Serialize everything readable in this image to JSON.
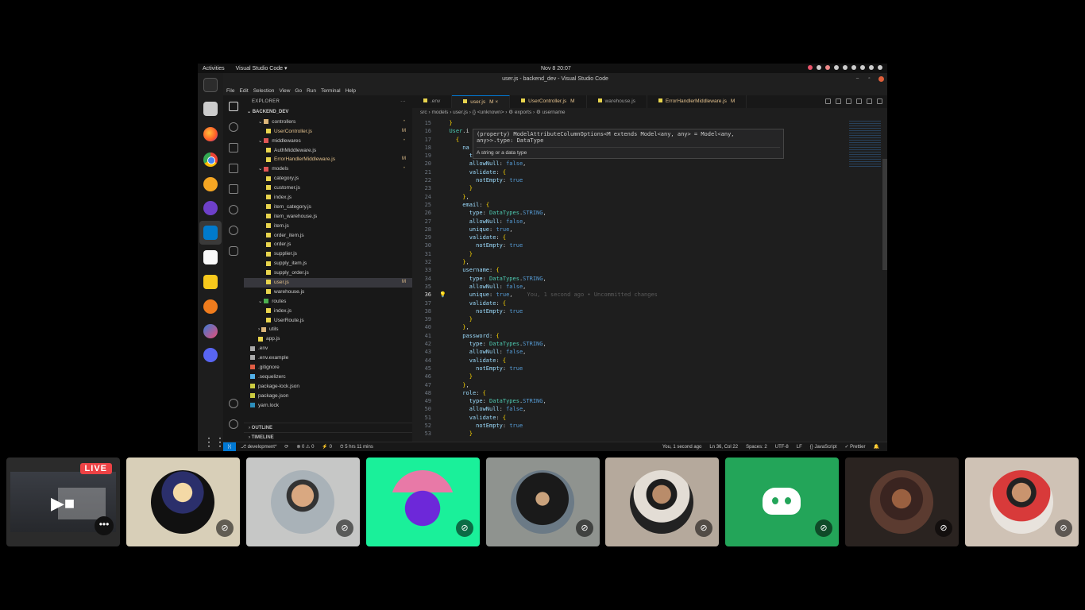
{
  "topbar": {
    "activities": "Activities",
    "app": "Visual Studio Code ▾",
    "clock": "Nov 8  20:07"
  },
  "window": {
    "title": "user.js - backend_dev - Visual Studio Code",
    "menu": [
      "File",
      "Edit",
      "Selection",
      "View",
      "Go",
      "Run",
      "Terminal",
      "Help"
    ]
  },
  "sidebar": {
    "title": "EXPLORER",
    "project": "BACKEND_DEV",
    "tree": [
      {
        "label": "controllers",
        "type": "folder",
        "indent": 1,
        "dot": "•"
      },
      {
        "label": "UserController.js",
        "type": "js",
        "indent": 2,
        "badge": "M"
      },
      {
        "label": "middlewares",
        "type": "folder mw",
        "indent": 1,
        "dot": "•"
      },
      {
        "label": "AuthMiddleware.js",
        "type": "js",
        "indent": 2
      },
      {
        "label": "ErrorHandlerMiddleware.js",
        "type": "js",
        "indent": 2,
        "badge": "M"
      },
      {
        "label": "models",
        "type": "folder mw",
        "indent": 1,
        "dot": "•"
      },
      {
        "label": "category.js",
        "type": "js",
        "indent": 2
      },
      {
        "label": "customer.js",
        "type": "js",
        "indent": 2
      },
      {
        "label": "index.js",
        "type": "js",
        "indent": 2
      },
      {
        "label": "item_category.js",
        "type": "js",
        "indent": 2
      },
      {
        "label": "item_warehouse.js",
        "type": "js",
        "indent": 2
      },
      {
        "label": "item.js",
        "type": "js",
        "indent": 2
      },
      {
        "label": "order_item.js",
        "type": "js",
        "indent": 2
      },
      {
        "label": "order.js",
        "type": "js",
        "indent": 2
      },
      {
        "label": "supplier.js",
        "type": "js",
        "indent": 2
      },
      {
        "label": "supply_item.js",
        "type": "js",
        "indent": 2
      },
      {
        "label": "supply_order.js",
        "type": "js",
        "indent": 2
      },
      {
        "label": "user.js",
        "type": "js",
        "indent": 2,
        "badge": "M",
        "selected": true
      },
      {
        "label": "warehouse.js",
        "type": "js",
        "indent": 2
      },
      {
        "label": "routes",
        "type": "folder rt",
        "indent": 1
      },
      {
        "label": "index.js",
        "type": "js",
        "indent": 2
      },
      {
        "label": "UserRoute.js",
        "type": "js",
        "indent": 2
      },
      {
        "label": "utils",
        "type": "folder",
        "indent": 1
      },
      {
        "label": "app.js",
        "type": "js",
        "indent": 1
      },
      {
        "label": ".env",
        "type": "env",
        "indent": 0
      },
      {
        "label": ".env.example",
        "type": "env",
        "indent": 0
      },
      {
        "label": ".gitignore",
        "type": "git",
        "indent": 0
      },
      {
        "label": ".sequelizerc",
        "type": "seq",
        "indent": 0
      },
      {
        "label": "package-lock.json",
        "type": "json",
        "indent": 0
      },
      {
        "label": "package.json",
        "type": "json",
        "indent": 0
      },
      {
        "label": "yarn.lock",
        "type": "yarn",
        "indent": 0
      }
    ],
    "outline": "OUTLINE",
    "timeline": "TIMELINE"
  },
  "tabs": [
    {
      "label": ".env",
      "active": false,
      "mod": false,
      "badge": ""
    },
    {
      "label": "user.js",
      "active": true,
      "mod": true,
      "badge": "M ×"
    },
    {
      "label": "UserController.js",
      "active": false,
      "mod": true,
      "badge": "M"
    },
    {
      "label": "warehouse.js",
      "active": false,
      "mod": false,
      "badge": ""
    },
    {
      "label": "ErrorHandlerMiddleware.js",
      "active": false,
      "mod": true,
      "badge": "M"
    }
  ],
  "breadcrumb": "src › models › user.js › {} <unknown> › ⚙ exports › ⚙ username",
  "hover": {
    "signature_line1": "(property) ModelAttributeColumnOptions<M extends Model<any, any> = Model<any,",
    "signature_line2": "any>>.type: DataType",
    "doc": "A string or a data type"
  },
  "code": [
    {
      "n": "15",
      "html": "  <span class='b'>}</span>"
    },
    {
      "n": "16",
      "html": "  <span class='t'>User</span>.i"
    },
    {
      "n": "17",
      "html": "    <span class='b'>{</span>"
    },
    {
      "n": "18",
      "html": "      <span class='p'>na</span>"
    },
    {
      "n": "19",
      "html": "        <span class='p'>type</span>: <span class='t'>DataTypes</span>.<span class='k'>STRING</span>,"
    },
    {
      "n": "20",
      "html": "        <span class='p'>allowNull</span>: <span class='k'>false</span>,"
    },
    {
      "n": "21",
      "html": "        <span class='p'>validate</span>: <span class='b'>{</span>"
    },
    {
      "n": "22",
      "html": "          <span class='p'>notEmpty</span>: <span class='k'>true</span>"
    },
    {
      "n": "23",
      "html": "        <span class='b'>}</span>"
    },
    {
      "n": "24",
      "html": "      <span class='b'>}</span>,"
    },
    {
      "n": "25",
      "html": "      <span class='p'>email</span>: <span class='b'>{</span>"
    },
    {
      "n": "26",
      "html": "        <span class='p'>type</span>: <span class='t'>DataTypes</span>.<span class='k'>STRING</span>,"
    },
    {
      "n": "27",
      "html": "        <span class='p'>allowNull</span>: <span class='k'>false</span>,"
    },
    {
      "n": "28",
      "html": "        <span class='p'>unique</span>: <span class='k'>true</span>,"
    },
    {
      "n": "29",
      "html": "        <span class='p'>validate</span>: <span class='b'>{</span>"
    },
    {
      "n": "30",
      "html": "          <span class='p'>notEmpty</span>: <span class='k'>true</span>"
    },
    {
      "n": "31",
      "html": "        <span class='b'>}</span>"
    },
    {
      "n": "32",
      "html": "      <span class='b'>}</span>,"
    },
    {
      "n": "33",
      "html": "      <span class='p'>username</span>: <span class='b'>{</span>"
    },
    {
      "n": "34",
      "html": "        <span class='p'>type</span>: <span class='t'>DataTypes</span>.<span class='k'>STRING</span>,"
    },
    {
      "n": "35",
      "html": "        <span class='p'>allowNull</span>: <span class='k'>false</span>,"
    },
    {
      "n": "36",
      "html": "        <span class='p'>unique</span>: <span class='k'>true</span>,<span class='blame'>You, 1 second ago • Uncommitted changes</span>",
      "current": true
    },
    {
      "n": "37",
      "html": "        <span class='p'>validate</span>: <span class='b'>{</span>"
    },
    {
      "n": "38",
      "html": "          <span class='p'>notEmpty</span>: <span class='k'>true</span>"
    },
    {
      "n": "39",
      "html": "        <span class='b'>}</span>"
    },
    {
      "n": "40",
      "html": "      <span class='b'>}</span>,"
    },
    {
      "n": "41",
      "html": "      <span class='p'>password</span>: <span class='b'>{</span>"
    },
    {
      "n": "42",
      "html": "        <span class='p'>type</span>: <span class='t'>DataTypes</span>.<span class='k'>STRING</span>,"
    },
    {
      "n": "43",
      "html": "        <span class='p'>allowNull</span>: <span class='k'>false</span>,"
    },
    {
      "n": "44",
      "html": "        <span class='p'>validate</span>: <span class='b'>{</span>"
    },
    {
      "n": "45",
      "html": "          <span class='p'>notEmpty</span>: <span class='k'>true</span>"
    },
    {
      "n": "46",
      "html": "        <span class='b'>}</span>"
    },
    {
      "n": "47",
      "html": "      <span class='b'>}</span>,"
    },
    {
      "n": "48",
      "html": "      <span class='p'>role</span>: <span class='b'>{</span>"
    },
    {
      "n": "49",
      "html": "        <span class='p'>type</span>: <span class='t'>DataTypes</span>.<span class='k'>STRING</span>,"
    },
    {
      "n": "50",
      "html": "        <span class='p'>allowNull</span>: <span class='k'>false</span>,"
    },
    {
      "n": "51",
      "html": "        <span class='p'>validate</span>: <span class='b'>{</span>"
    },
    {
      "n": "52",
      "html": "          <span class='p'>notEmpty</span>: <span class='k'>true</span>"
    },
    {
      "n": "53",
      "html": "        <span class='b'>}</span>"
    }
  ],
  "statusbar": {
    "branch": "development*",
    "problems": "⊗ 0 ⚠ 0",
    "extra": "0",
    "time": "5 hrs 11 mins",
    "blame": "You, 1 second ago",
    "position": "Ln 36, Col 22",
    "spaces": "Spaces: 2",
    "encoding": "UTF-8",
    "eol": "LF",
    "language": "JavaScript",
    "formatter": "Prettier"
  },
  "call": {
    "live_badge": "LIVE",
    "more_label": "•••",
    "camera_icon": "camera-icon",
    "mute_icon": "muted-mic-icon"
  },
  "colors": {
    "live": "#ed4245",
    "discord_green": "#23a559",
    "vscode_accent": "#0078d4"
  }
}
